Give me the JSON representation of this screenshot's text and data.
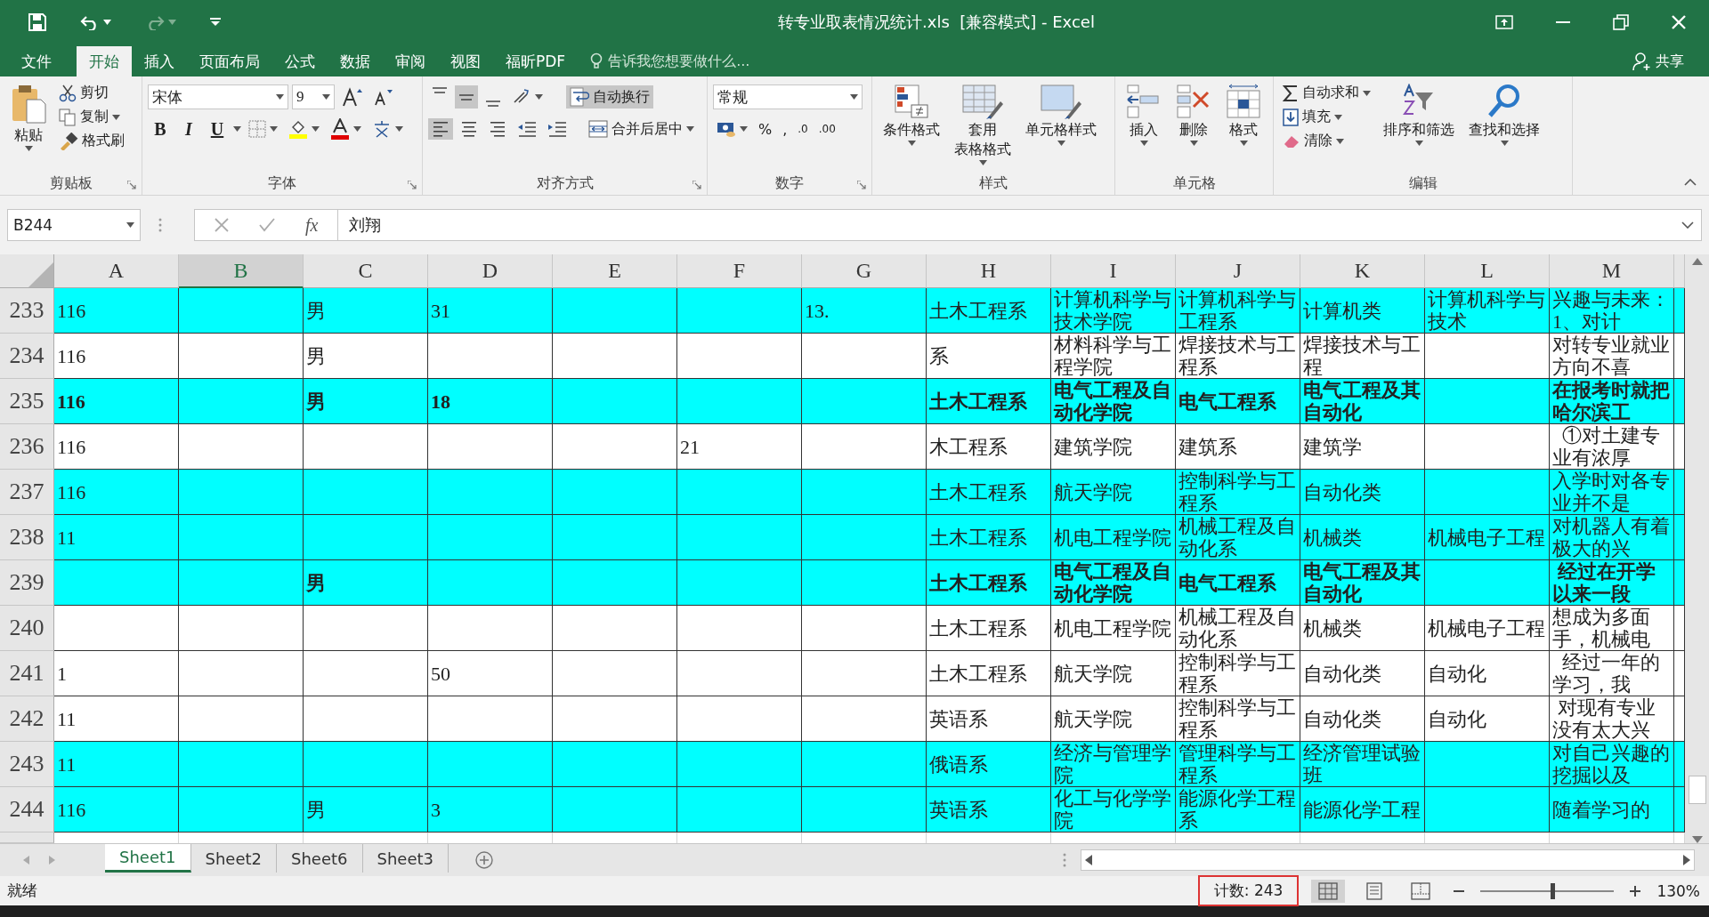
{
  "title_bar": {
    "title": "转专业取表情况统计.xls  [兼容模式] - Excel"
  },
  "menu": {
    "tabs": [
      {
        "label": "文件",
        "selected": false
      },
      {
        "label": "开始",
        "selected": true
      },
      {
        "label": "插入",
        "selected": false
      },
      {
        "label": "页面布局",
        "selected": false
      },
      {
        "label": "公式",
        "selected": false
      },
      {
        "label": "数据",
        "selected": false
      },
      {
        "label": "审阅",
        "selected": false
      },
      {
        "label": "视图",
        "selected": false
      },
      {
        "label": "福昕PDF",
        "selected": false
      }
    ],
    "tell_me": {
      "placeholder": "告诉我您想要做什么..."
    },
    "share": "共享"
  },
  "ribbon": {
    "clipboard": {
      "label": "剪贴板",
      "paste": "粘贴",
      "cut": "剪切",
      "copy": "复制",
      "format_painter": "格式刷"
    },
    "font": {
      "label": "字体",
      "font_name": "宋体",
      "font_size": "9",
      "bold": "B",
      "italic": "I",
      "underline": "U"
    },
    "alignment": {
      "label": "对齐方式",
      "vertical": [
        {
          "selected": false
        },
        {
          "selected": true
        },
        {
          "selected": false
        }
      ],
      "horizontal": [
        {
          "selected": true
        },
        {
          "selected": false
        },
        {
          "selected": false
        }
      ],
      "wrap_text": {
        "label": "自动换行",
        "on": true
      },
      "merge_center": "合并后居中"
    },
    "number": {
      "label": "数字",
      "format": "常规",
      "percent": "%",
      "comma": ",",
      "increase_decimal": ".0",
      "decrease_decimal": ".00"
    },
    "styles": {
      "label": "样式",
      "buttons": [
        {
          "lines": [
            "条件格式"
          ]
        },
        {
          "lines": [
            "套用",
            "表格格式"
          ]
        },
        {
          "lines": [
            "单元格样式"
          ]
        }
      ]
    },
    "cells": {
      "label": "单元格",
      "buttons": [
        "插入",
        "删除",
        "格式"
      ]
    },
    "editing": {
      "label": "编辑",
      "autosum": "自动求和",
      "fill": "填充",
      "clear": "清除",
      "sort_filter": "排序和筛选",
      "find_select": "查找和选择"
    }
  },
  "formula_bar": {
    "name_box": "B244",
    "fx": "fx",
    "value": "刘翔"
  },
  "sheet": {
    "columns": [
      {
        "label": "A",
        "selected": false
      },
      {
        "label": "B",
        "selected": true
      },
      {
        "label": "C",
        "selected": false
      },
      {
        "label": "D",
        "selected": false
      },
      {
        "label": "E",
        "selected": false
      },
      {
        "label": "F",
        "selected": false
      },
      {
        "label": "G",
        "selected": false
      },
      {
        "label": "H",
        "selected": false
      },
      {
        "label": "I",
        "selected": false
      },
      {
        "label": "J",
        "selected": false
      },
      {
        "label": "K",
        "selected": false
      },
      {
        "label": "L",
        "selected": false
      },
      {
        "label": "M",
        "selected": false
      }
    ],
    "rows": [
      {
        "number": "233",
        "highlighted": true,
        "bold": false,
        "cells": {
          "a": "116",
          "c": "男",
          "d": "31",
          "g": "13.",
          "h": "土木工程系",
          "i": "计算机科学与技术学院",
          "j": "计算机科学与工程系",
          "k": "计算机类",
          "l": "计算机科学与技术",
          "m": "兴趣与未来：1、对计"
        }
      },
      {
        "number": "234",
        "highlighted": false,
        "bold": false,
        "cells": {
          "a": "116",
          "c": "男",
          "h": "系",
          "i": "材料科学与工程学院",
          "j": "焊接技术与工程系",
          "k": "焊接技术与工程",
          "m": "对转专业就业方向不喜"
        }
      },
      {
        "number": "235",
        "highlighted": true,
        "bold": true,
        "cells": {
          "a": "116",
          "c": "男",
          "d": "18",
          "h": "土木工程系",
          "i": "电气工程及自动化学院",
          "j": "电气工程系",
          "k": "电气工程及其自动化",
          "m": "在报考时就把哈尔滨工"
        }
      },
      {
        "number": "236",
        "highlighted": false,
        "bold": false,
        "cells": {
          "a": "116",
          "f": "21",
          "h": "木工程系",
          "i": "建筑学院",
          "j": "建筑系",
          "k": "建筑学",
          "m": "  ①对土建专业有浓厚"
        }
      },
      {
        "number": "237",
        "highlighted": true,
        "bold": false,
        "cells": {
          "a": "116",
          "h": "土木工程系",
          "i": "航天学院",
          "j": "控制科学与工程系",
          "k": "自动化类",
          "m": "入学时对各专业并不是"
        }
      },
      {
        "number": "238",
        "highlighted": true,
        "bold": false,
        "cells": {
          "a": "11",
          "h": "土木工程系",
          "i": "机电工程学院",
          "j": "机械工程及自动化系",
          "k": "机械类",
          "l": "机械电子工程",
          "m": "对机器人有着极大的兴"
        }
      },
      {
        "number": "239",
        "highlighted": true,
        "bold": true,
        "cells": {
          "c": "男",
          "h": "土木工程系",
          "i": "电气工程及自动化学院",
          "j": "电气工程系",
          "k": "电气工程及其自动化",
          "m": " 经过在开学以来一段"
        }
      },
      {
        "number": "240",
        "highlighted": false,
        "bold": false,
        "cells": {
          "h": "土木工程系",
          "i": "机电工程学院",
          "j": "机械工程及自动化系",
          "k": "机械类",
          "l": "机械电子工程",
          "m": "想成为多面手，机械电"
        }
      },
      {
        "number": "241",
        "highlighted": false,
        "bold": false,
        "cells": {
          "a": "1",
          "d": "50",
          "h": "土木工程系",
          "i": "航天学院",
          "j": "控制科学与工程系",
          "k": "自动化类",
          "l": "自动化",
          "m": "  经过一年的学习，我"
        }
      },
      {
        "number": "242",
        "highlighted": false,
        "bold": false,
        "cells": {
          "a": "11",
          "h": "英语系",
          "i": "航天学院",
          "j": "控制科学与工程系",
          "k": "自动化类",
          "l": "自动化",
          "m": " 对现有专业没有太大兴"
        }
      },
      {
        "number": "243",
        "highlighted": true,
        "bold": false,
        "cells": {
          "a": "11",
          "h": "俄语系",
          "i": "经济与管理学院",
          "j": "管理科学与工程系",
          "k": "经济管理试验班",
          "m": "对自己兴趣的挖掘以及"
        }
      },
      {
        "number": "244",
        "highlighted": true,
        "bold": false,
        "cells": {
          "a": "116",
          "c": "男",
          "d": "3",
          "h": "英语系",
          "i": "化工与化学学院",
          "j": "能源化学工程系",
          "k": "能源化学工程",
          "m": "随着学习的"
        }
      }
    ]
  },
  "sheet_tabs": [
    {
      "label": "Sheet1",
      "selected": true
    },
    {
      "label": "Sheet2",
      "selected": false
    },
    {
      "label": "Sheet6",
      "selected": false
    },
    {
      "label": "Sheet3",
      "selected": false
    }
  ],
  "status_bar": {
    "ready": "就绪",
    "count": "计数: 243",
    "views": [
      {
        "kind": "normal",
        "selected": true
      },
      {
        "kind": "page_layout",
        "selected": false
      },
      {
        "kind": "page_break",
        "selected": false
      }
    ],
    "zoom_slider": {
      "level": 0.54
    },
    "zoom": "130%"
  }
}
